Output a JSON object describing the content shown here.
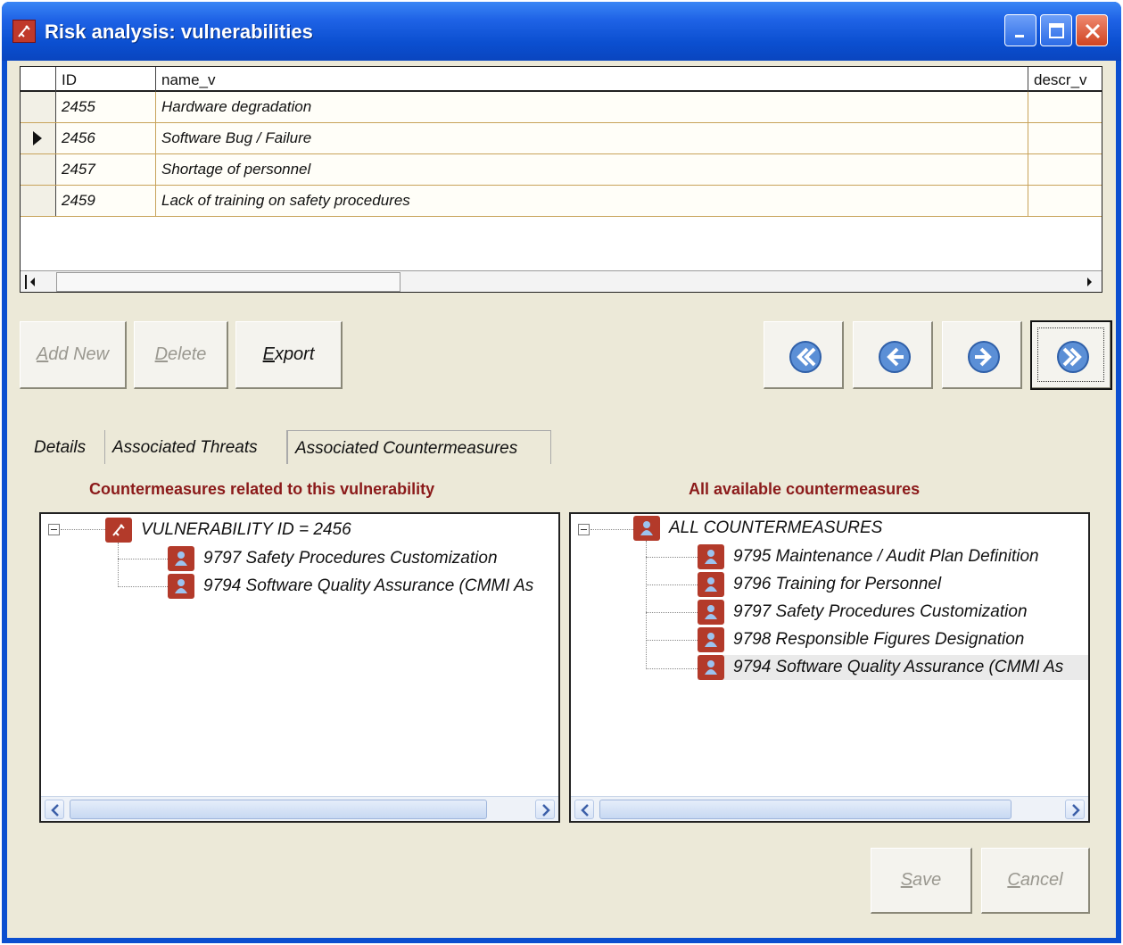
{
  "window": {
    "title": "Risk analysis: vulnerabilities",
    "title_icon": "app-icon",
    "controls": [
      "minimize-icon",
      "maximize-icon",
      "close-icon"
    ]
  },
  "grid": {
    "columns": [
      {
        "label": "ID"
      },
      {
        "label": "name_v"
      },
      {
        "label": "descr_v"
      }
    ],
    "rows": [
      {
        "id": "2455",
        "name": "Hardware degradation",
        "current": false
      },
      {
        "id": "2456",
        "name": "Software Bug / Failure",
        "current": true
      },
      {
        "id": "2457",
        "name": "Shortage of personnel",
        "current": false
      },
      {
        "id": "2459",
        "name": "Lack of training on safety procedures",
        "current": false
      }
    ]
  },
  "toolbar": {
    "add_new": {
      "prefix": "",
      "accel": "A",
      "rest": "dd New",
      "enabled": false
    },
    "delete": {
      "prefix": "",
      "accel": "D",
      "rest": "elete",
      "enabled": false
    },
    "export": {
      "prefix": "",
      "accel": "E",
      "rest": "xport",
      "enabled": true
    }
  },
  "navigation": {
    "buttons": [
      "first-record-icon",
      "previous-record-icon",
      "next-record-icon",
      "last-record-icon"
    ]
  },
  "tabs": [
    {
      "label": "Details",
      "active": false
    },
    {
      "label": "Associated Threats",
      "active": false
    },
    {
      "label": "Associated Countermeasures",
      "active": true
    }
  ],
  "left_panel": {
    "title": "Countermeasures related to this vulnerability",
    "root": "VULNERABILITY ID = 2456",
    "items": [
      "9797 Safety Procedures Customization",
      "9794 Software Quality Assurance (CMMI As"
    ]
  },
  "right_panel": {
    "title": "All available countermeasures",
    "root": "ALL COUNTERMEASURES",
    "items": [
      "9795 Maintenance / Audit Plan Definition",
      "9796 Training for Personnel",
      "9797 Safety Procedures Customization",
      "9798 Responsible Figures Designation",
      "9794 Software Quality Assurance (CMMI As"
    ]
  },
  "footer": {
    "save": {
      "prefix": "",
      "accel": "S",
      "rest": "ave",
      "enabled": false
    },
    "cancel": {
      "prefix": "",
      "accel": "C",
      "rest": "ancel",
      "enabled": false
    }
  },
  "colors": {
    "titlebar": "#0b4fd0",
    "panel_title": "#8b1a1a",
    "tree_icon": "#b33a2a",
    "window_bg": "#ece9d8"
  }
}
